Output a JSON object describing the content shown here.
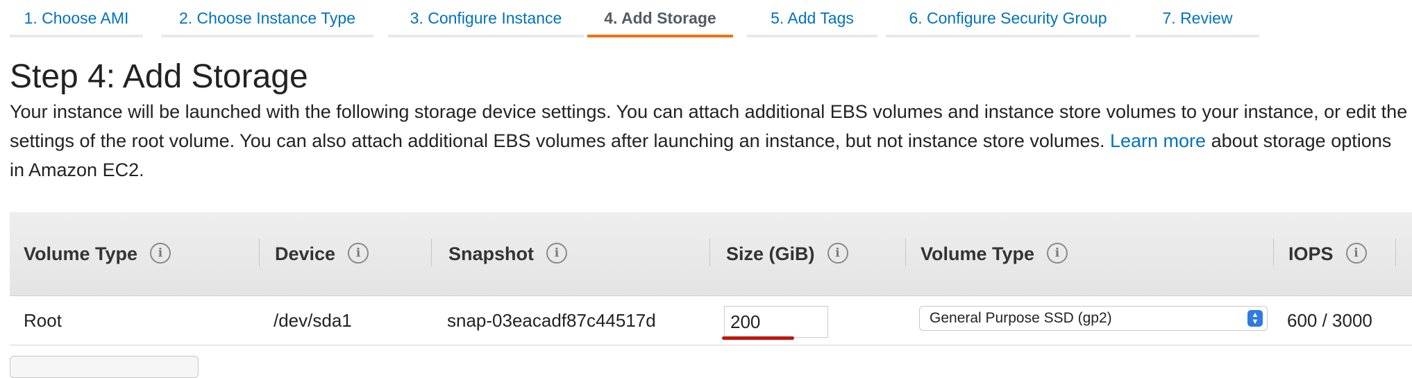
{
  "tabs": [
    {
      "label": "1. Choose AMI"
    },
    {
      "label": "2. Choose Instance Type"
    },
    {
      "label": "3. Configure Instance"
    },
    {
      "label": "4. Add Storage"
    },
    {
      "label": "5. Add Tags"
    },
    {
      "label": "6. Configure Security Group"
    },
    {
      "label": "7. Review"
    }
  ],
  "active_tab": "4. Add Storage",
  "page_title": "Step 4: Add Storage",
  "description": {
    "text_before_link": "Your instance will be launched with the following storage device settings. You can attach additional EBS volumes and instance store volumes to your instance, or edit the settings of the root volume. You can also attach additional EBS volumes after launching an instance, but not instance store volumes.",
    "link": "Learn more",
    "text_after_link": "about storage options in Amazon EC2."
  },
  "table": {
    "headers": [
      "Volume Type",
      "Device",
      "Snapshot",
      "Size (GiB)",
      "Volume Type",
      "IOPS"
    ],
    "row": {
      "volume_type": "Root",
      "device": "/dev/sda1",
      "snapshot": "snap-03eacadf87c44517d",
      "size": "200",
      "volume_type_select": "General Purpose SSD (gp2)",
      "iops": "600 / 3000"
    }
  },
  "icons": {
    "info": "info-circle-icon",
    "select": "select-arrows-icon"
  },
  "colors": {
    "link": "#0073bb",
    "active_tab_underline": "#ec7211",
    "annotation_underline": "#c0180c"
  }
}
